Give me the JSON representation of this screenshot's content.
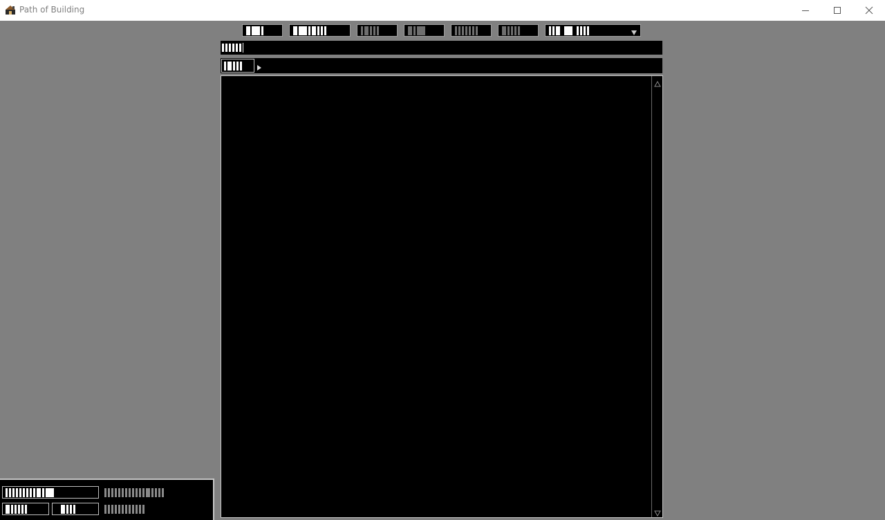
{
  "window": {
    "title": "Path of Building",
    "minimize_icon": "minimize-icon",
    "maximize_icon": "maximize-icon",
    "close_icon": "close-icon"
  },
  "toolbar": {
    "buttons": [
      {
        "name": "toolbar-button-1",
        "enabled": true
      },
      {
        "name": "toolbar-button-2",
        "enabled": true
      },
      {
        "name": "toolbar-button-3",
        "enabled": false
      },
      {
        "name": "toolbar-button-4",
        "enabled": false
      },
      {
        "name": "toolbar-button-5",
        "enabled": false
      },
      {
        "name": "toolbar-button-6",
        "enabled": false
      }
    ],
    "dropdown_icon": "dropdown-arrow-icon"
  },
  "colors": {
    "background": "#808080",
    "panel": "#000000",
    "border": "#c8c8c8",
    "text": "#ffffff",
    "disabled_text": "#6f6f6f"
  }
}
